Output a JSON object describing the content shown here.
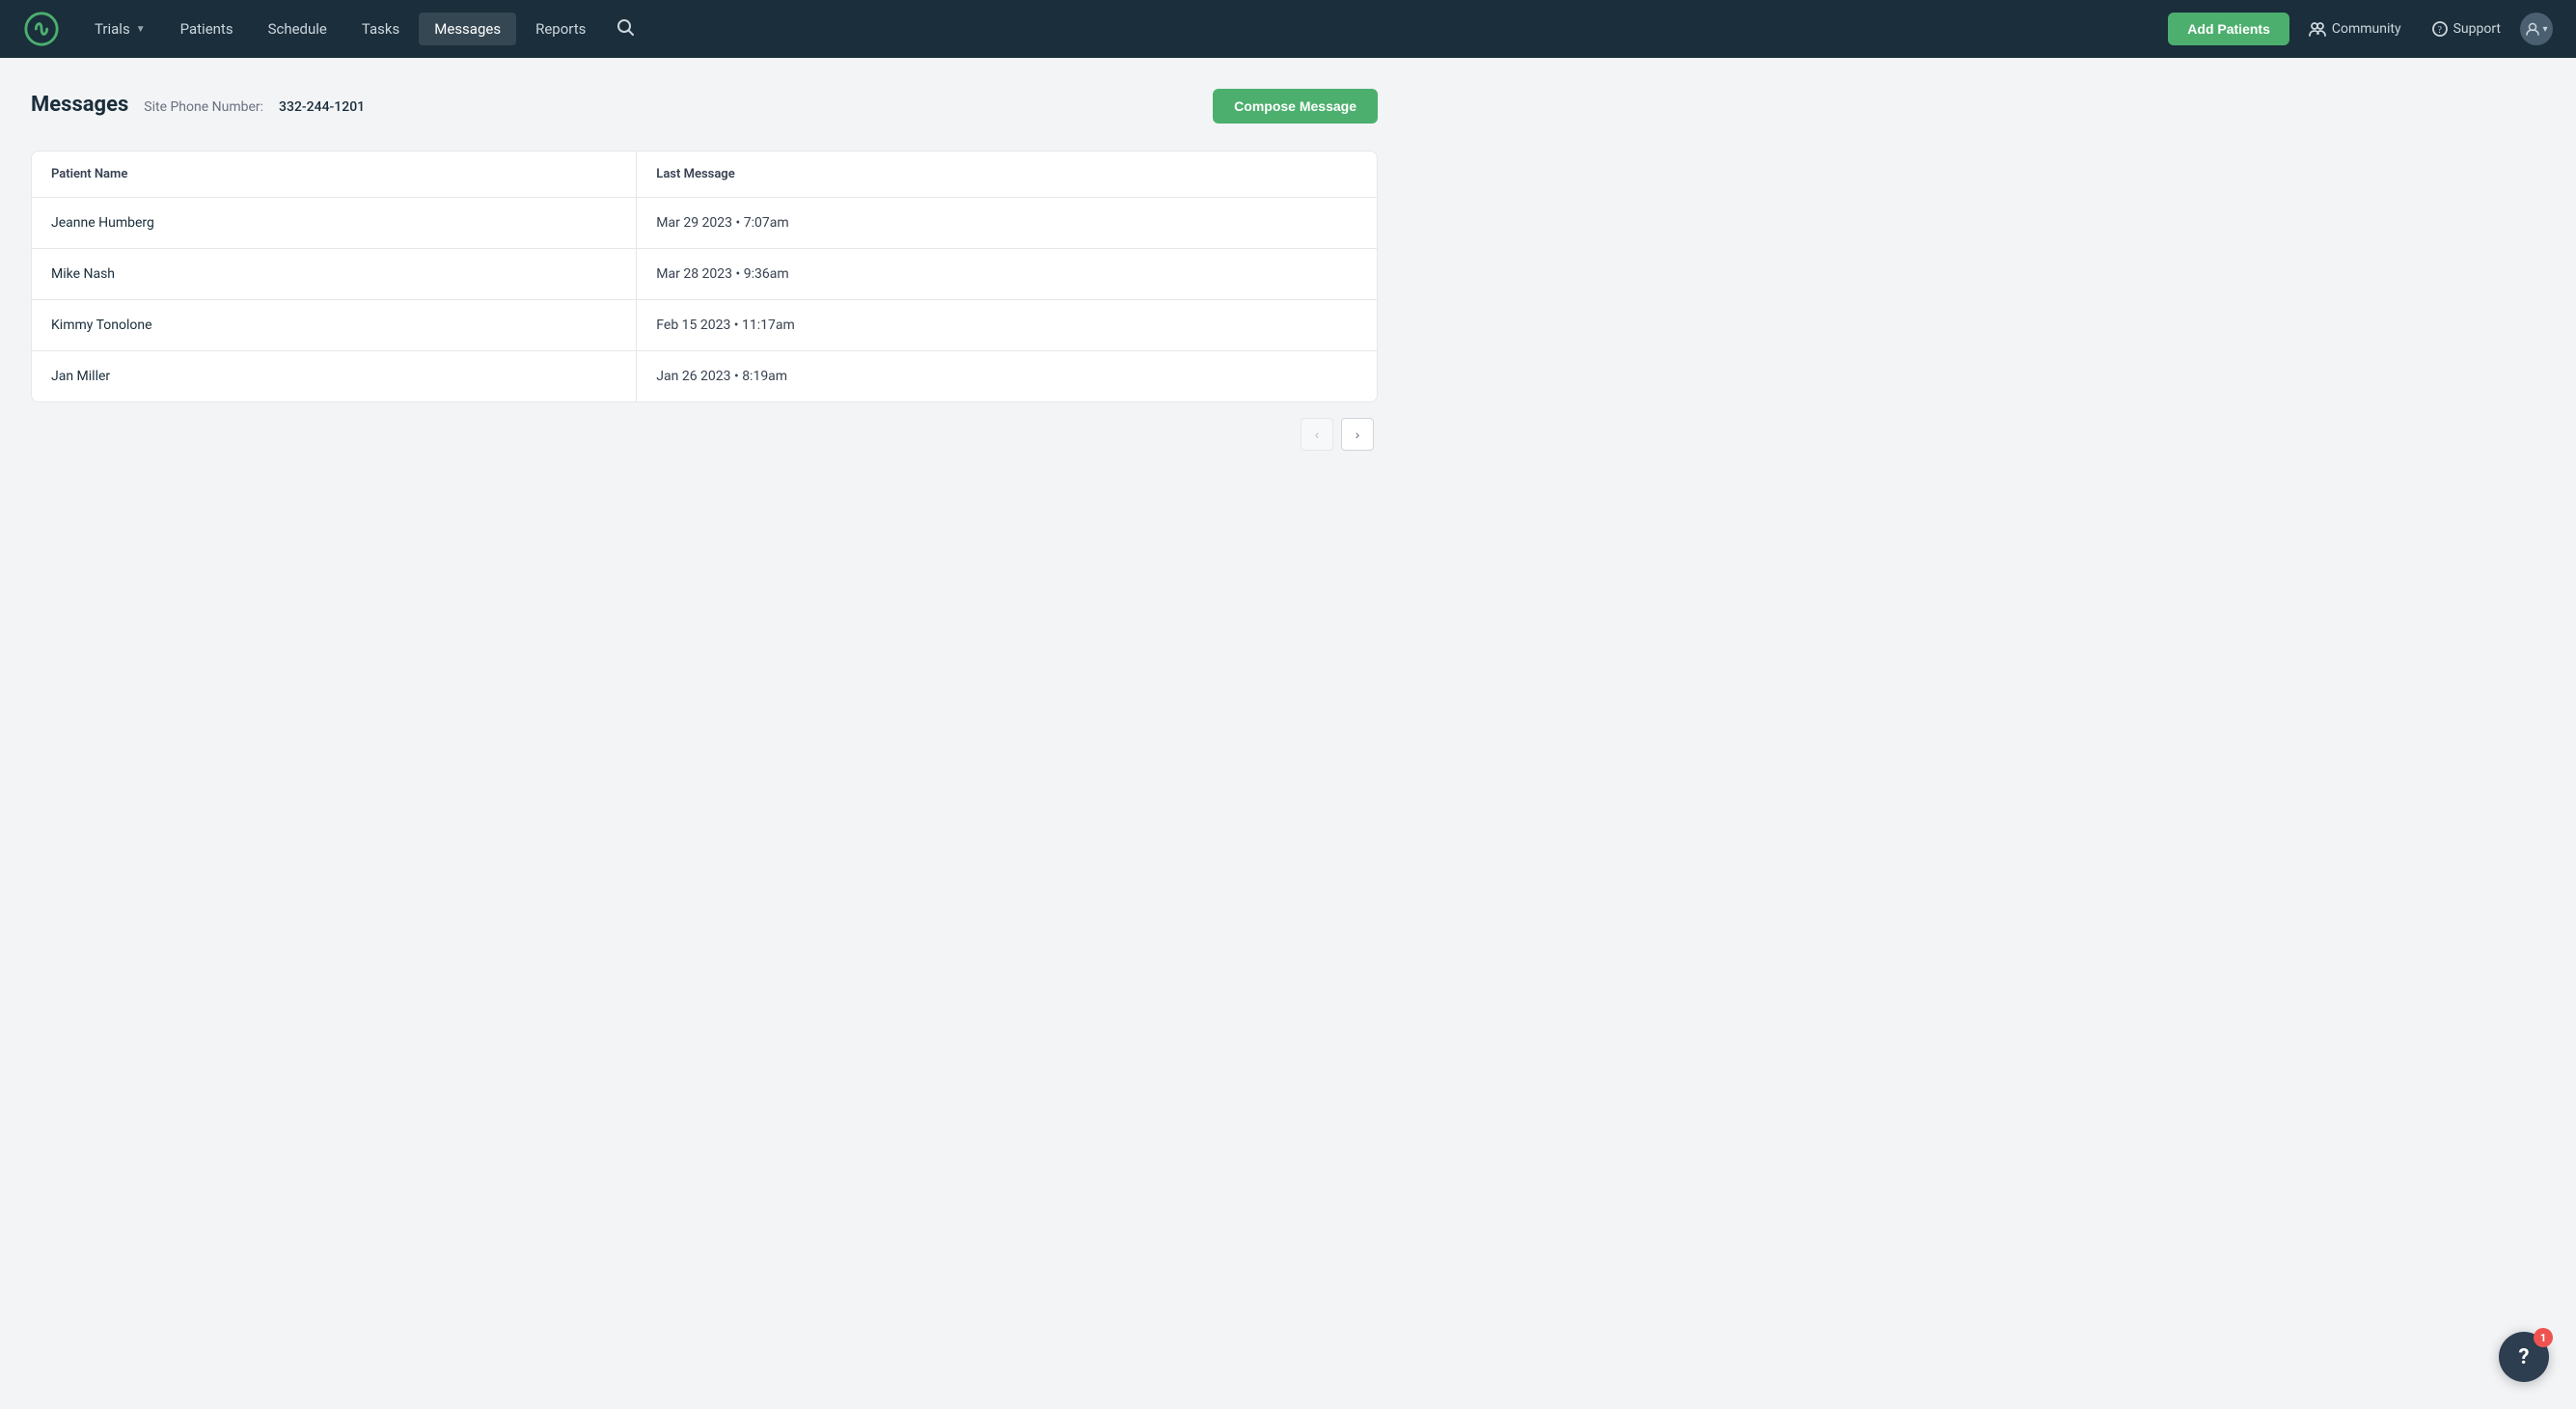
{
  "nav": {
    "logo_alt": "Logo",
    "links": [
      {
        "label": "Trials",
        "has_dropdown": true,
        "active": false
      },
      {
        "label": "Patients",
        "has_dropdown": false,
        "active": false
      },
      {
        "label": "Schedule",
        "has_dropdown": false,
        "active": false
      },
      {
        "label": "Tasks",
        "has_dropdown": false,
        "active": false
      },
      {
        "label": "Messages",
        "has_dropdown": false,
        "active": true
      },
      {
        "label": "Reports",
        "has_dropdown": false,
        "active": false
      }
    ],
    "add_patients_label": "Add Patients",
    "community_label": "Community",
    "support_label": "Support"
  },
  "page": {
    "title": "Messages",
    "site_phone_label": "Site Phone Number:",
    "site_phone_number": "332-244-1201",
    "compose_button": "Compose Message"
  },
  "table": {
    "col_patient_name": "Patient Name",
    "col_last_message": "Last Message",
    "rows": [
      {
        "patient_name": "Jeanne Humberg",
        "last_message": "Mar 29 2023 • 7:07am"
      },
      {
        "patient_name": "Mike Nash",
        "last_message": "Mar 28 2023 • 9:36am"
      },
      {
        "patient_name": "Kimmy Tonolone",
        "last_message": "Feb 15 2023 • 11:17am"
      },
      {
        "patient_name": "Jan Miller",
        "last_message": "Jan 26 2023 • 8:19am"
      }
    ]
  },
  "pagination": {
    "prev_label": "‹",
    "next_label": "›"
  },
  "help": {
    "badge_count": "1",
    "icon": "?"
  },
  "colors": {
    "accent_green": "#4caf6e",
    "nav_bg": "#1a2e3b"
  }
}
